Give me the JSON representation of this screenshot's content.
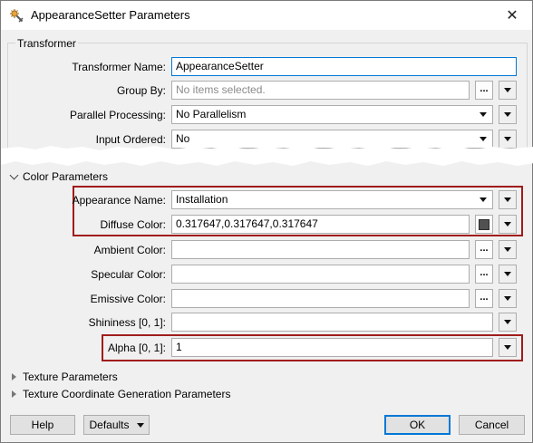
{
  "window": {
    "title": "AppearanceSetter Parameters",
    "close_glyph": "✕"
  },
  "transformer_section": {
    "label": "Transformer",
    "rows": {
      "name": {
        "label": "Transformer Name:",
        "value": "AppearanceSetter"
      },
      "group_by": {
        "label": "Group By:",
        "placeholder": "No items selected."
      },
      "parallel": {
        "label": "Parallel Processing:",
        "value": "No Parallelism"
      },
      "input_ordered": {
        "label": "Input Ordered:",
        "value": "No"
      }
    }
  },
  "color_section": {
    "label": "Color Parameters",
    "rows": {
      "appearance_name": {
        "label": "Appearance Name:",
        "value": "Installation"
      },
      "diffuse": {
        "label": "Diffuse Color:",
        "value": "0.317647,0.317647,0.317647",
        "swatch_color": "#515151"
      },
      "ambient": {
        "label": "Ambient Color:",
        "value": ""
      },
      "specular": {
        "label": "Specular Color:",
        "value": ""
      },
      "emissive": {
        "label": "Emissive Color:",
        "value": ""
      },
      "shininess": {
        "label": "Shininess [0, 1]:",
        "value": ""
      },
      "alpha": {
        "label": "Alpha [0, 1]:",
        "value": "1"
      }
    }
  },
  "collapsed_sections": {
    "texture": "Texture Parameters",
    "texture_coord": "Texture Coordinate Generation Parameters"
  },
  "buttons": {
    "help": "Help",
    "defaults": "Defaults",
    "ok": "OK",
    "cancel": "Cancel",
    "ellipsis": "..."
  },
  "colors": {
    "highlight": "#a01c1c",
    "focus": "#0078d7"
  }
}
